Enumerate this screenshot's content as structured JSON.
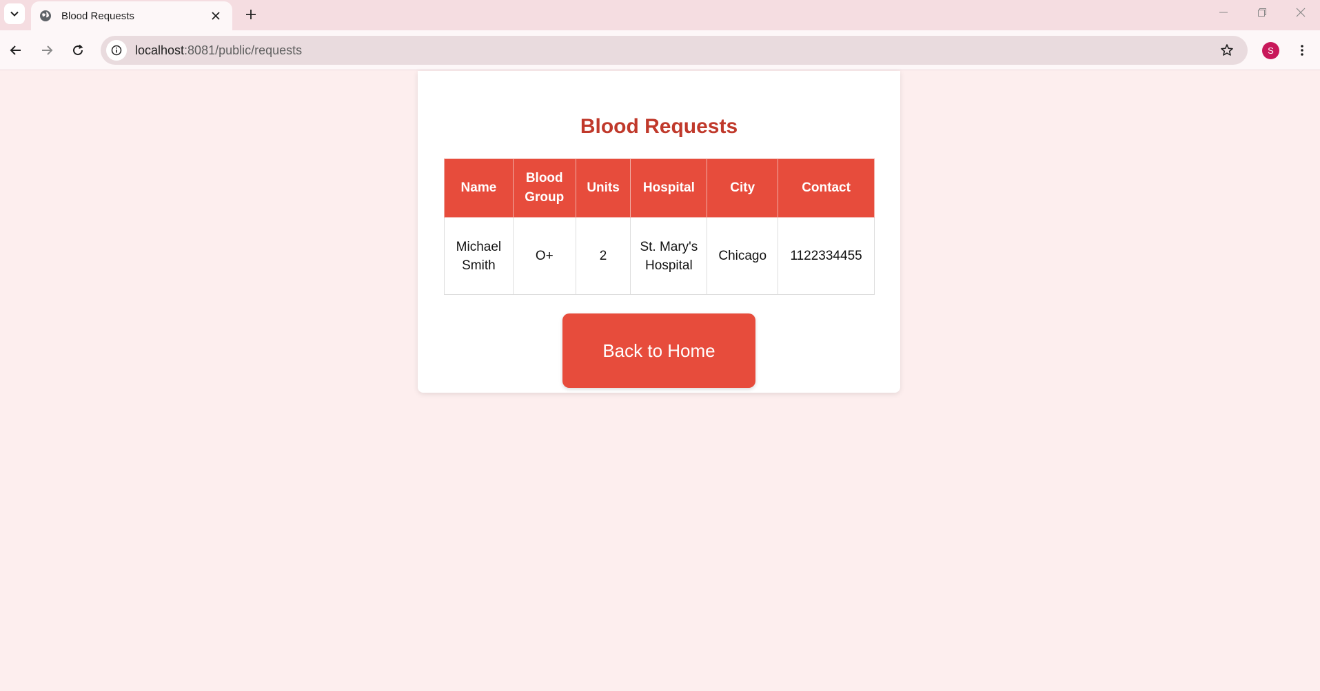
{
  "browser": {
    "tab_title": "Blood Requests",
    "url_host": "localhost",
    "url_path": ":8081/public/requests",
    "avatar_letter": "S"
  },
  "page": {
    "title": "Blood Requests",
    "table": {
      "headers": [
        "Name",
        "Blood Group",
        "Units",
        "Hospital",
        "City",
        "Contact"
      ],
      "rows": [
        [
          "Michael Smith",
          "O+",
          "2",
          "St. Mary's Hospital",
          "Chicago",
          "1122334455"
        ]
      ]
    },
    "back_button": "Back to Home"
  },
  "colors": {
    "accent": "#e74c3c",
    "title": "#c0392b",
    "background": "#fdeeee"
  }
}
